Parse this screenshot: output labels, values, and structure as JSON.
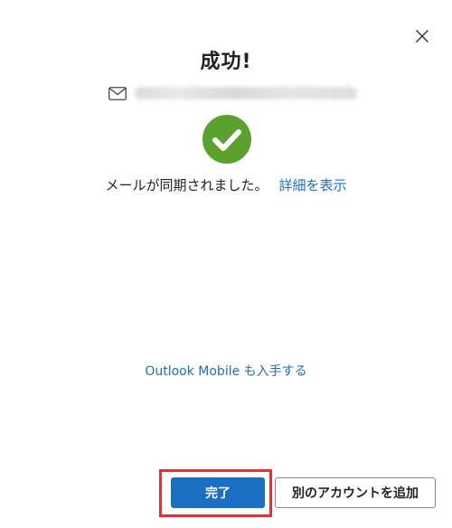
{
  "dialog": {
    "title": "成功!",
    "email_icon": "mail-icon",
    "status_icon": "checkmark-circle-icon",
    "status_icon_color": "#5aa12d",
    "status_message": "メールが同期されました。",
    "details_link": "詳細を表示",
    "outlook_mobile_link": "Outlook Mobile も入手する",
    "close_icon": "close-icon"
  },
  "footer": {
    "done_button": "完了",
    "add_account_button": "別のアカウントを追加"
  },
  "colors": {
    "accent": "#1a6fc2",
    "link": "#1d6fc4",
    "highlight": "#e53238"
  }
}
